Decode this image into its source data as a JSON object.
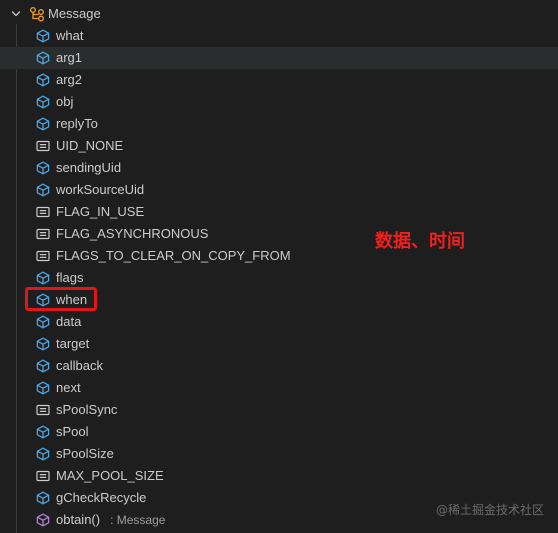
{
  "root": {
    "label": "Message",
    "expanded": true,
    "icon": "class-icon"
  },
  "members": [
    {
      "label": "what",
      "kind": "field",
      "icon": "field-icon"
    },
    {
      "label": "arg1",
      "kind": "field",
      "icon": "field-icon",
      "hovered": true
    },
    {
      "label": "arg2",
      "kind": "field",
      "icon": "field-icon"
    },
    {
      "label": "obj",
      "kind": "field",
      "icon": "field-icon"
    },
    {
      "label": "replyTo",
      "kind": "field",
      "icon": "field-icon"
    },
    {
      "label": "UID_NONE",
      "kind": "constant",
      "icon": "constant-icon"
    },
    {
      "label": "sendingUid",
      "kind": "field",
      "icon": "field-icon"
    },
    {
      "label": "workSourceUid",
      "kind": "field",
      "icon": "field-icon"
    },
    {
      "label": "FLAG_IN_USE",
      "kind": "constant",
      "icon": "constant-icon"
    },
    {
      "label": "FLAG_ASYNCHRONOUS",
      "kind": "constant",
      "icon": "constant-icon"
    },
    {
      "label": "FLAGS_TO_CLEAR_ON_COPY_FROM",
      "kind": "constant",
      "icon": "constant-icon"
    },
    {
      "label": "flags",
      "kind": "field",
      "icon": "field-icon"
    },
    {
      "label": "when",
      "kind": "field",
      "icon": "field-icon",
      "highlighted": true
    },
    {
      "label": "data",
      "kind": "field",
      "icon": "field-icon"
    },
    {
      "label": "target",
      "kind": "field",
      "icon": "field-icon"
    },
    {
      "label": "callback",
      "kind": "field",
      "icon": "field-icon"
    },
    {
      "label": "next",
      "kind": "field",
      "icon": "field-icon"
    },
    {
      "label": "sPoolSync",
      "kind": "constant",
      "icon": "constant-icon"
    },
    {
      "label": "sPool",
      "kind": "field",
      "icon": "field-icon"
    },
    {
      "label": "sPoolSize",
      "kind": "field",
      "icon": "field-icon"
    },
    {
      "label": "MAX_POOL_SIZE",
      "kind": "constant",
      "icon": "constant-icon"
    },
    {
      "label": "gCheckRecycle",
      "kind": "field",
      "icon": "field-icon"
    },
    {
      "label": "obtain()",
      "kind": "method",
      "icon": "method-icon",
      "detail": ": Message"
    }
  ],
  "annotation": {
    "text": "数据、时间",
    "color": "#ef2020"
  },
  "watermark": {
    "text": "@稀土掘金技术社区"
  },
  "colors": {
    "background": "#1e1e1e",
    "hover_row": "#2a2d2e",
    "field_icon": "#4fa3e0",
    "constant_icon": "#cccccc",
    "method_icon": "#b180d7",
    "class_icon": "#ee9d28",
    "highlight_border": "#e0161b"
  }
}
